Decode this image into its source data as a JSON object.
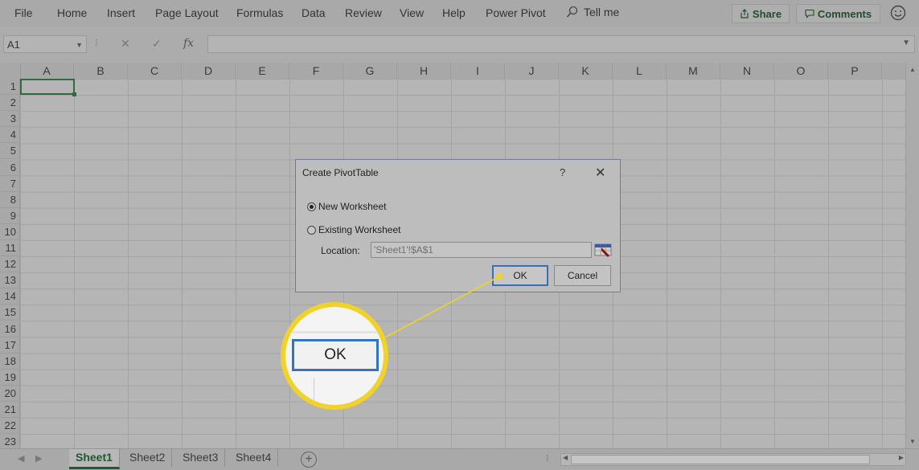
{
  "menu": {
    "items": [
      "File",
      "Home",
      "Insert",
      "Page Layout",
      "Formulas",
      "Data",
      "Review",
      "View",
      "Help",
      "Power Pivot"
    ],
    "tell_me": "Tell me",
    "share": "Share",
    "comments": "Comments"
  },
  "formula_bar": {
    "name_box": "A1",
    "fx": "fx",
    "cancel_symbol": "✕",
    "enter_symbol": "✓",
    "value": ""
  },
  "grid": {
    "columns": [
      "A",
      "B",
      "C",
      "D",
      "E",
      "F",
      "G",
      "H",
      "I",
      "J",
      "K",
      "L",
      "M",
      "N",
      "O",
      "P"
    ],
    "rows": [
      "1",
      "2",
      "3",
      "4",
      "5",
      "6",
      "7",
      "8",
      "9",
      "10",
      "11",
      "12",
      "13",
      "14",
      "15",
      "16",
      "17",
      "18",
      "19",
      "20",
      "21",
      "22",
      "23"
    ],
    "active_cell": "A1"
  },
  "sheets": {
    "tabs": [
      "Sheet1",
      "Sheet2",
      "Sheet3",
      "Sheet4"
    ],
    "active": "Sheet1",
    "add": "+"
  },
  "dialog": {
    "title": "Create PivotTable",
    "help": "?",
    "close": "✕",
    "option_new": "New Worksheet",
    "option_existing": "Existing Worksheet",
    "selected_option": "New Worksheet",
    "location_label": "Location:",
    "location_value": "'Sheet1'!$A$1",
    "ok": "OK",
    "cancel": "Cancel"
  },
  "callout": {
    "zoomed_label": "OK",
    "color": "#f0d22a"
  },
  "colors": {
    "accent_green": "#1f5a30",
    "focus_blue": "#3a6fb5"
  }
}
